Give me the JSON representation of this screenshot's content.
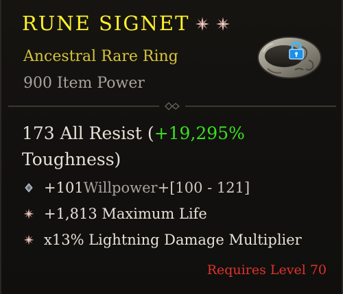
{
  "item": {
    "name": "RUNE SIGNET",
    "type": "Ancestral Rare Ring",
    "power": "900 Item Power",
    "sockets": [
      "gem-socket-star-icon",
      "gem-socket-star-icon"
    ],
    "image": "rune-ring-icon",
    "lock": "padlock-icon"
  },
  "main_stat": {
    "value": "173 All Resist",
    "open": " (",
    "bonus": "+19,295%",
    "suffix": " Toughness)"
  },
  "affixes": [
    {
      "icon": "diamond-bullet-icon",
      "value": "+101",
      "name": " Willpower",
      "range": " +[100 - 121]"
    },
    {
      "icon": "burst-star-icon",
      "value": "+1,813 Maximum Life"
    },
    {
      "icon": "burst-star-icon",
      "value": "x13% Lightning Damage Multiplier"
    }
  ],
  "requirement": "Requires Level 70",
  "colors": {
    "name": "#fff12a",
    "type": "#d6c43a",
    "bonus": "#39e021",
    "requirement": "#e0332d",
    "background": "#12110f"
  }
}
